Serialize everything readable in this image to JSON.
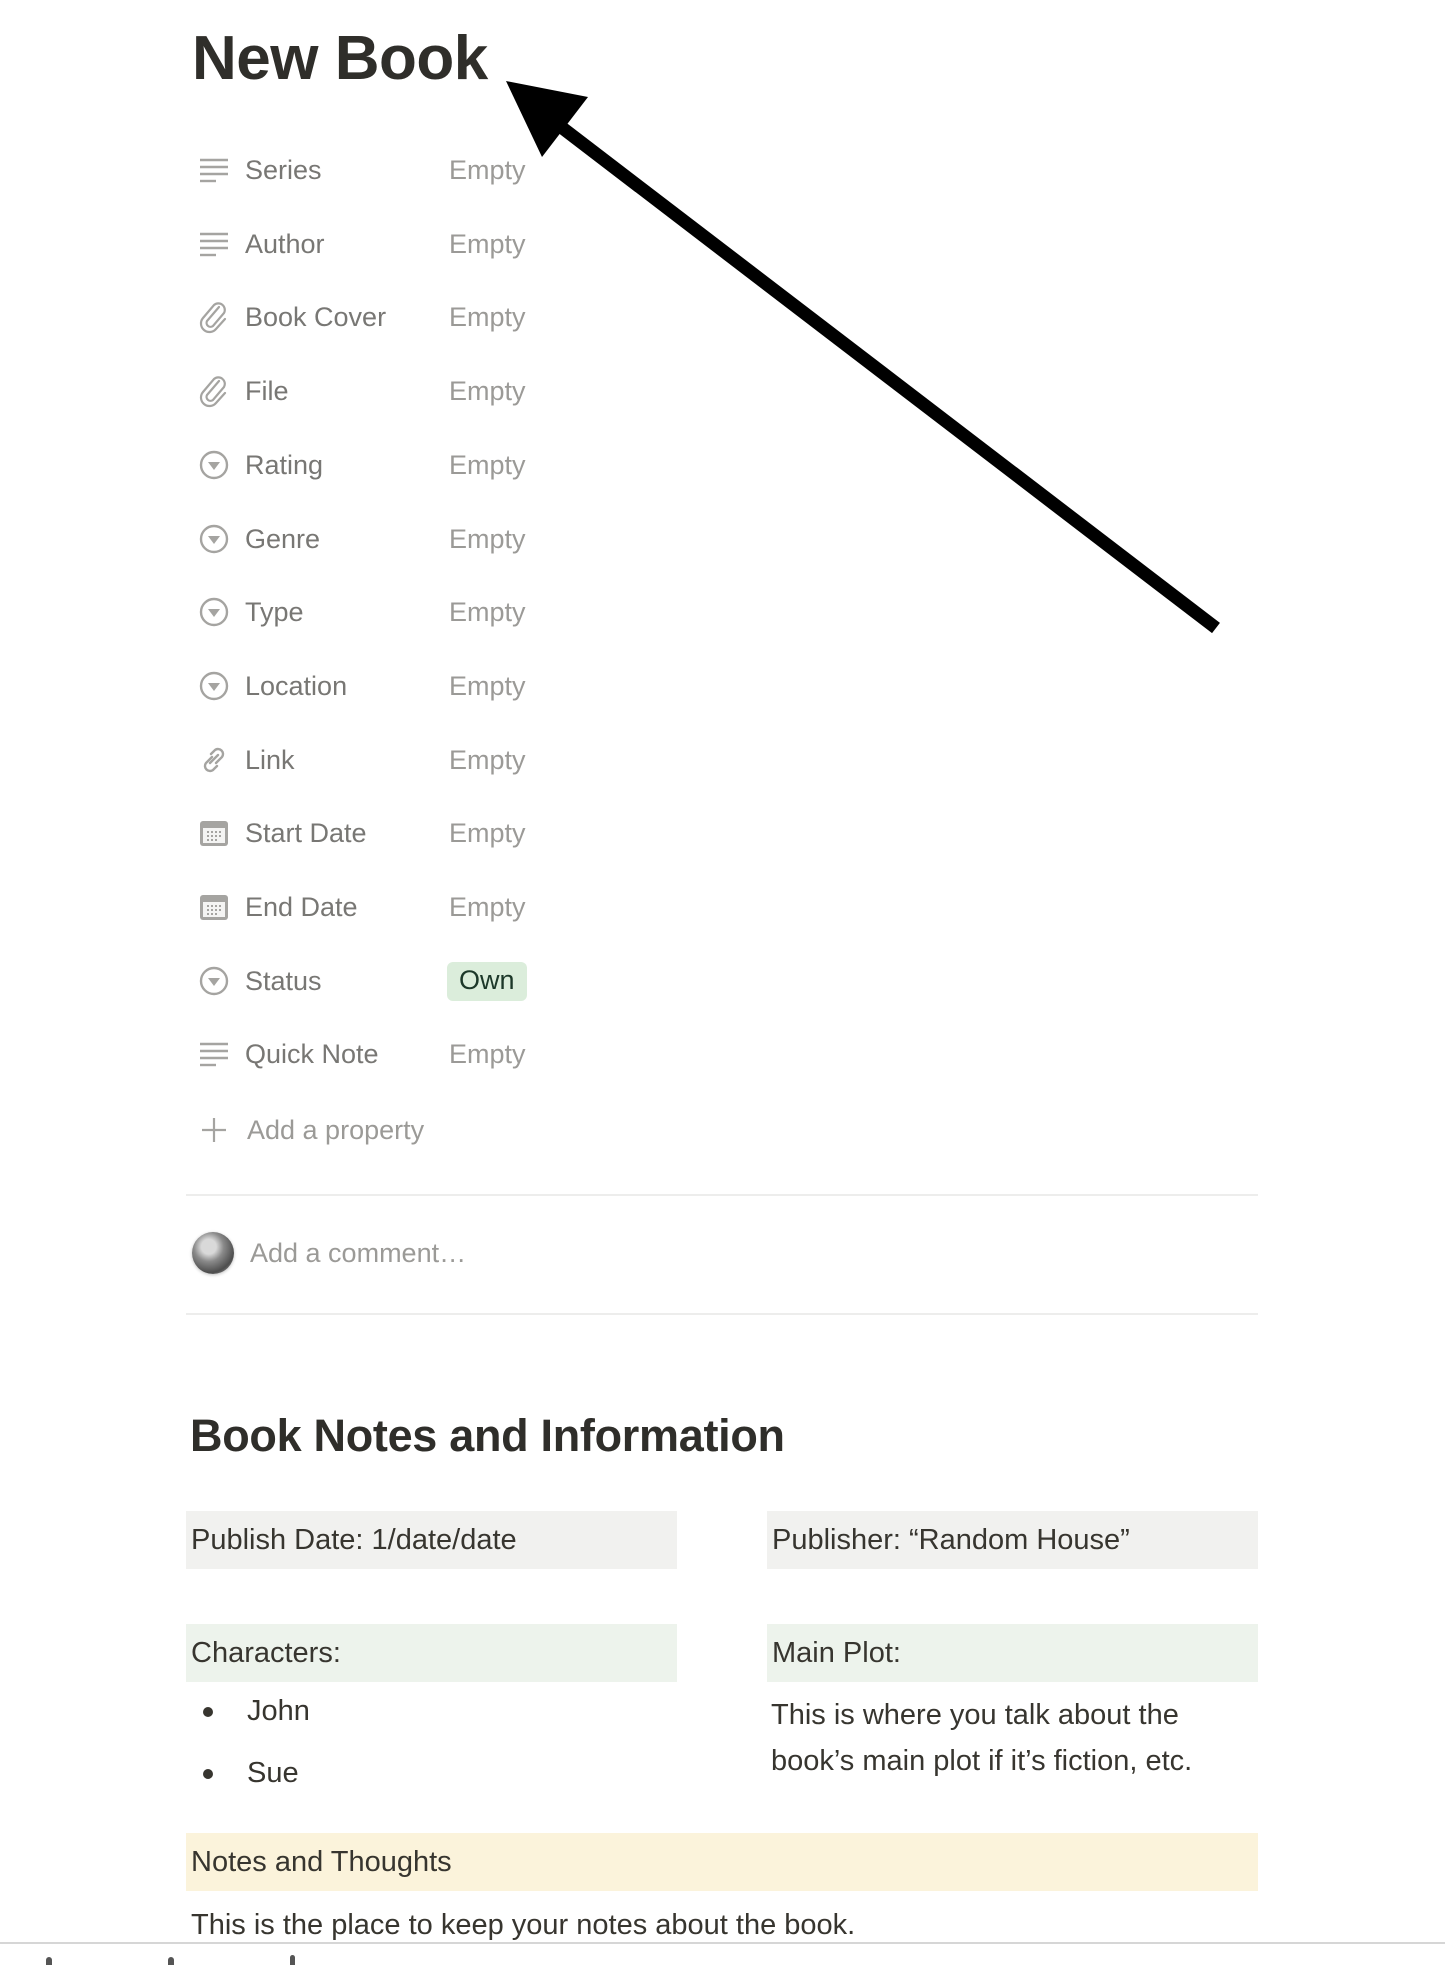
{
  "page": {
    "title": "New Book"
  },
  "properties": [
    {
      "icon": "text-lines-icon",
      "label": "Series",
      "value": "Empty"
    },
    {
      "icon": "text-lines-icon",
      "label": "Author",
      "value": "Empty"
    },
    {
      "icon": "paperclip-icon",
      "label": "Book Cover",
      "value": "Empty"
    },
    {
      "icon": "paperclip-icon",
      "label": "File",
      "value": "Empty"
    },
    {
      "icon": "select-circle-icon",
      "label": "Rating",
      "value": "Empty"
    },
    {
      "icon": "select-circle-icon",
      "label": "Genre",
      "value": "Empty"
    },
    {
      "icon": "select-circle-icon",
      "label": "Type",
      "value": "Empty"
    },
    {
      "icon": "select-circle-icon",
      "label": "Location",
      "value": "Empty"
    },
    {
      "icon": "link-icon",
      "label": "Link",
      "value": "Empty"
    },
    {
      "icon": "calendar-icon",
      "label": "Start Date",
      "value": "Empty"
    },
    {
      "icon": "calendar-icon",
      "label": "End Date",
      "value": "Empty"
    },
    {
      "icon": "select-circle-icon",
      "label": "Status",
      "value": "Own",
      "badge": true,
      "badge_bg": "#dbeddb",
      "badge_fg": "#1c3829"
    },
    {
      "icon": "text-lines-icon",
      "label": "Quick Note",
      "value": "Empty"
    }
  ],
  "add_property": {
    "label": "Add a property",
    "icon": "plus-icon"
  },
  "comment": {
    "placeholder": "Add a comment…",
    "avatar": "user-avatar"
  },
  "notes": {
    "heading": "Book Notes and Information",
    "publish_date": "Publish Date: 1/date/date",
    "publisher": "Publisher: “Random House”",
    "characters_label": "Characters:",
    "characters": [
      "John",
      "Sue"
    ],
    "main_plot_label": "Main Plot:",
    "main_plot_text_line1": "This is where you talk about the",
    "main_plot_text_line2": "book’s main plot if it’s fiction, etc.",
    "thoughts_label": "Notes and Thoughts",
    "thoughts_text": "This is the place to keep your notes about the book."
  },
  "colors": {
    "callout_gray": "#f1f1ef",
    "callout_green": "#edf3ec",
    "callout_yellow": "#fbf3db",
    "annotation_arrow": "#000000"
  },
  "annotation": {
    "type": "arrow",
    "points_to": "page-title"
  }
}
